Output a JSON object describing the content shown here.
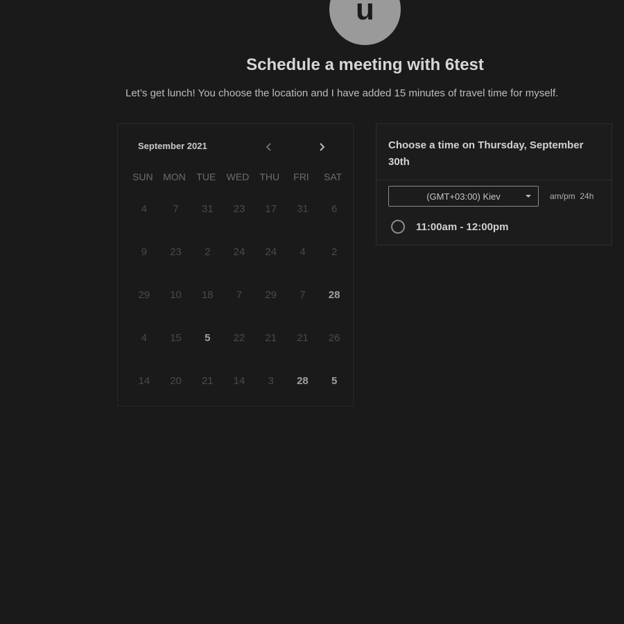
{
  "avatar": {
    "letter": "u"
  },
  "header": {
    "title": "Schedule a meeting with 6test",
    "subtitle": "Let’s get lunch! You choose the location and I have added 15 minutes of travel time for myself."
  },
  "calendar": {
    "month_label": "September 2021",
    "prev_icon": "chevron-left-icon",
    "next_icon": "chevron-right-icon",
    "weekdays": [
      "SUN",
      "MON",
      "TUE",
      "WED",
      "THU",
      "FRI",
      "SAT"
    ],
    "days": [
      {
        "label": "4",
        "bright": false
      },
      {
        "label": "7",
        "bright": false
      },
      {
        "label": "31",
        "bright": false
      },
      {
        "label": "23",
        "bright": false
      },
      {
        "label": "17",
        "bright": false
      },
      {
        "label": "31",
        "bright": false
      },
      {
        "label": "6",
        "bright": false
      },
      {
        "label": "9",
        "bright": false
      },
      {
        "label": "23",
        "bright": false
      },
      {
        "label": "2",
        "bright": false
      },
      {
        "label": "24",
        "bright": false
      },
      {
        "label": "24",
        "bright": false
      },
      {
        "label": "4",
        "bright": false
      },
      {
        "label": "2",
        "bright": false
      },
      {
        "label": "29",
        "bright": false
      },
      {
        "label": "10",
        "bright": false
      },
      {
        "label": "18",
        "bright": false
      },
      {
        "label": "7",
        "bright": false
      },
      {
        "label": "29",
        "bright": false
      },
      {
        "label": "7",
        "bright": false
      },
      {
        "label": "28",
        "bright": true
      },
      {
        "label": "4",
        "bright": false
      },
      {
        "label": "15",
        "bright": false
      },
      {
        "label": "5",
        "bright": true
      },
      {
        "label": "22",
        "bright": false
      },
      {
        "label": "21",
        "bright": false
      },
      {
        "label": "21",
        "bright": false
      },
      {
        "label": "26",
        "bright": false
      },
      {
        "label": "14",
        "bright": false
      },
      {
        "label": "20",
        "bright": false
      },
      {
        "label": "21",
        "bright": false
      },
      {
        "label": "14",
        "bright": false
      },
      {
        "label": "3",
        "bright": false
      },
      {
        "label": "28",
        "bright": true
      },
      {
        "label": "5",
        "bright": true
      }
    ]
  },
  "time_panel": {
    "heading": "Choose a time on Thursday, September 30th",
    "timezone": "(GMT+03:00) Kiev",
    "format_ampm": "am/pm",
    "format_24h": "24h",
    "slots": [
      {
        "label": "11:00am - 12:00pm"
      }
    ]
  }
}
